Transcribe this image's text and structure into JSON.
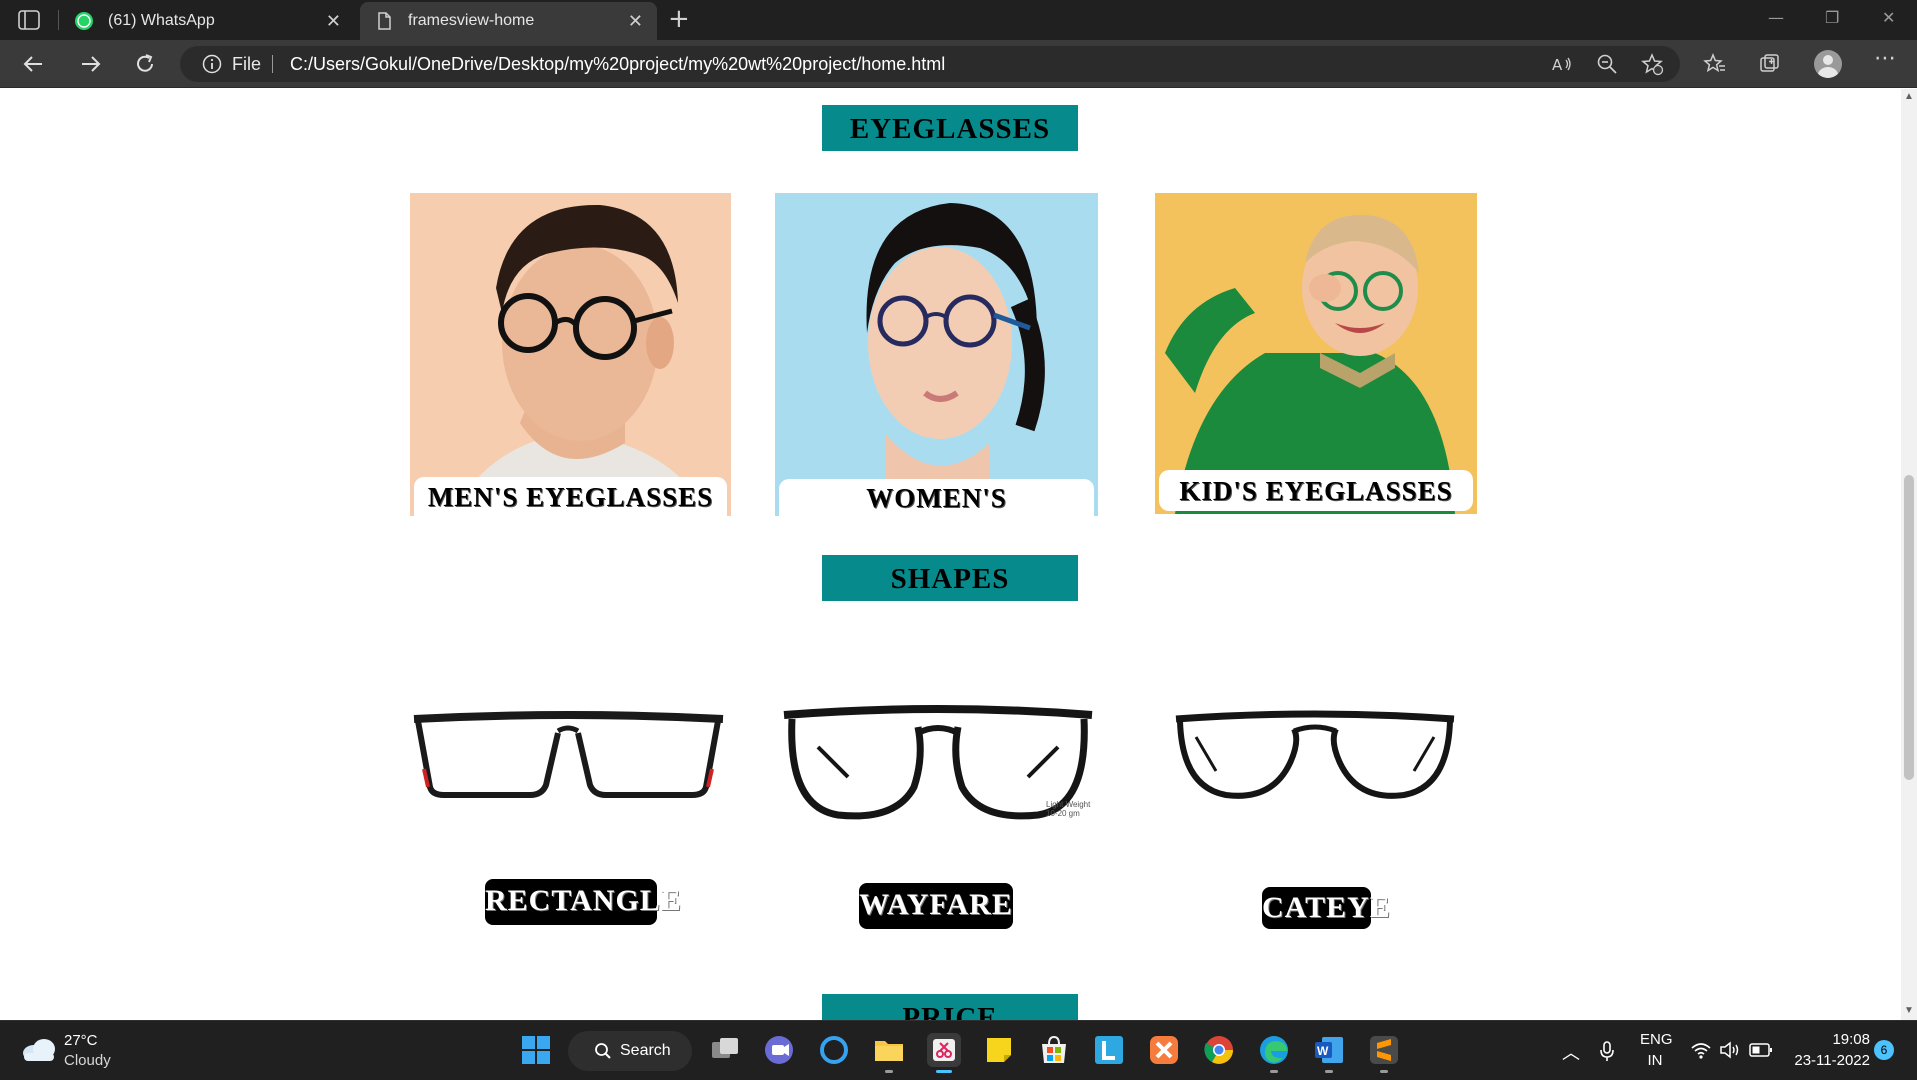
{
  "browser": {
    "tabs": [
      {
        "title": "(61) WhatsApp",
        "badge": "61"
      },
      {
        "title": "framesview-home"
      }
    ],
    "file_label": "File",
    "url": "C:/Users/Gokul/OneDrive/Desktop/my%20project/my%20wt%20project/home.html"
  },
  "page": {
    "eyeglasses_heading": "EYEGLASSES",
    "categories": [
      {
        "label": "MEN'S EYEGLASSES",
        "image": "man-wearing-glasses-photo",
        "bg": "#f6c9a8"
      },
      {
        "label": "WOMEN'S EYEGLASSES",
        "image": "woman-wearing-glasses-photo",
        "bg": "#a9dcef"
      },
      {
        "label": "KID'S EYEGLASSES",
        "image": "kid-wearing-glasses-photo",
        "bg": "#f3c05a"
      }
    ],
    "shapes_heading": "SHAPES",
    "shapes": [
      {
        "label": "RECTANGLE"
      },
      {
        "label": "WAYFARE",
        "caption_line1": "Light Weight",
        "caption_line2": "10-20 gm"
      },
      {
        "label": "CATEYE"
      }
    ],
    "price_heading": "PRICE"
  },
  "taskbar": {
    "temperature": "27°C",
    "weather": "Cloudy",
    "search_label": "Search",
    "language": "ENG",
    "region": "IN",
    "time": "19:08",
    "date": "23-11-2022",
    "notification_count": "6"
  },
  "colors": {
    "heading_bg": "#078a8c",
    "chrome_dark": "#202020",
    "address_bar": "#3a3a3a"
  }
}
